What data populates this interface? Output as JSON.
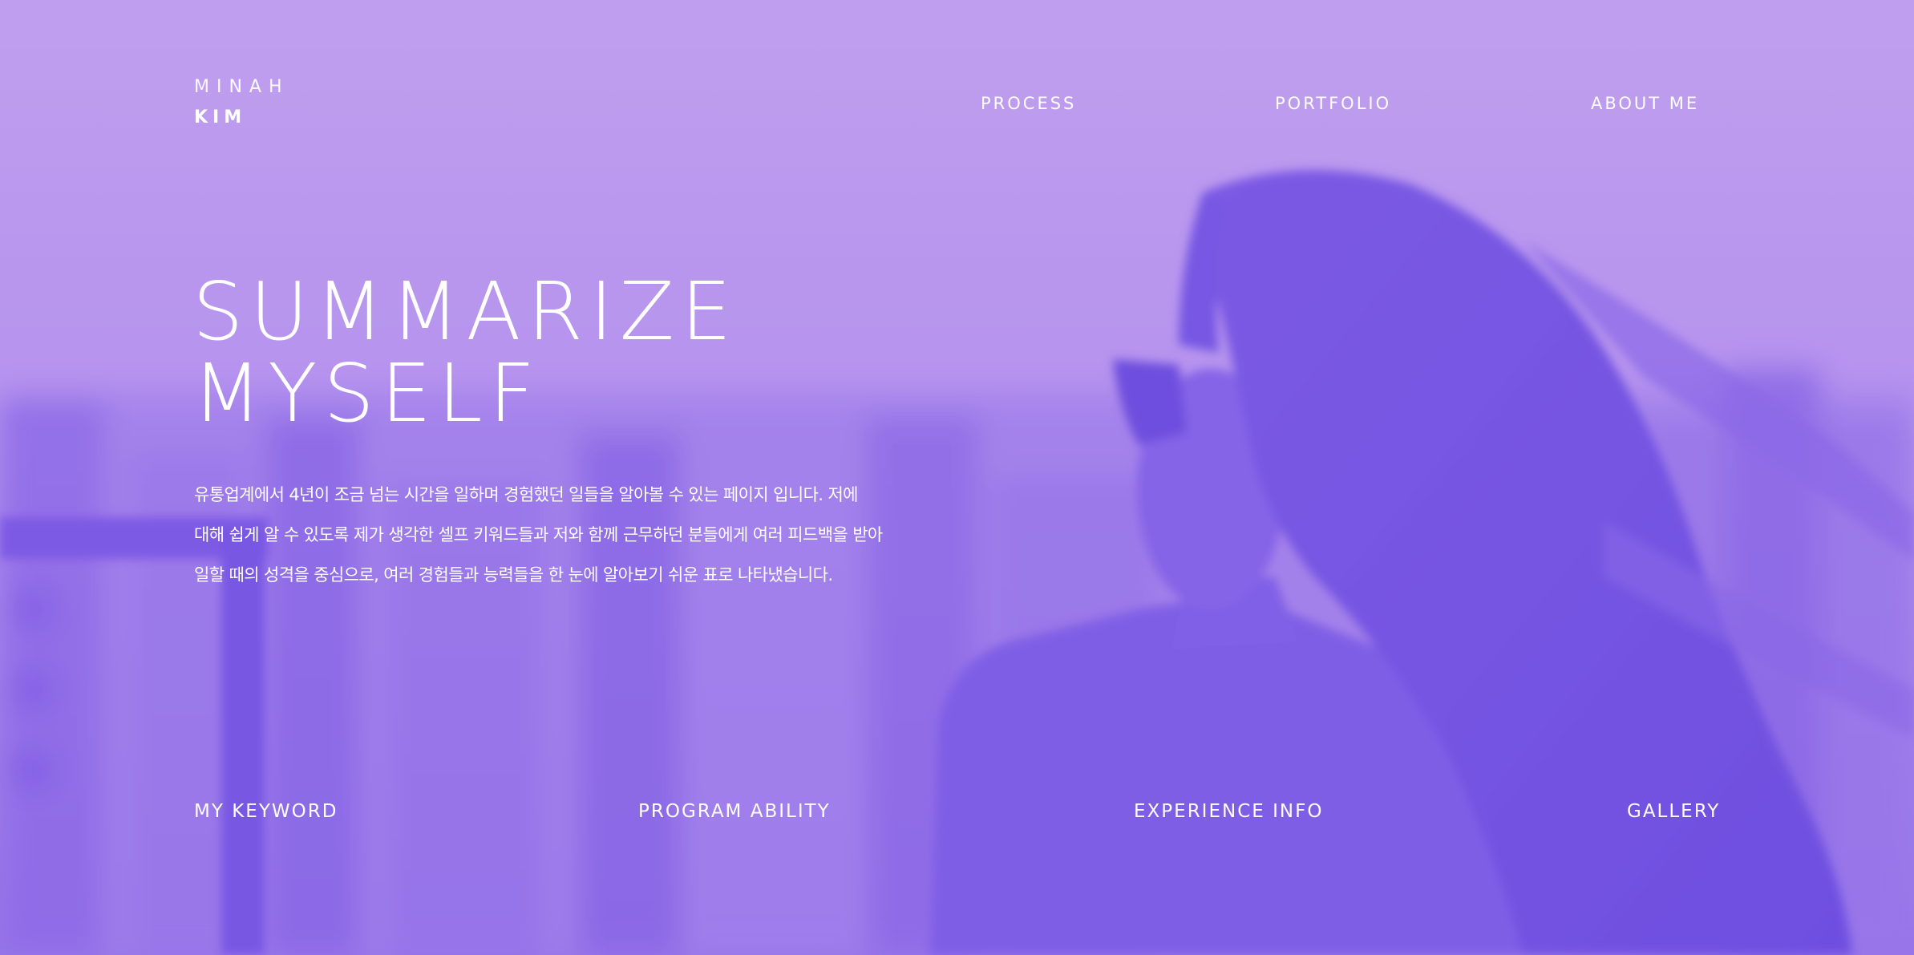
{
  "logo": {
    "first_name": "MINAH",
    "last_name": "KIM"
  },
  "top_nav": {
    "items": [
      "PROCESS",
      "PORTFOLIO",
      "ABOUT ME"
    ]
  },
  "hero": {
    "title_line1": "SUMMARIZE",
    "title_line2": "MYSELF",
    "description": "유통업계에서 4년이 조금 넘는 시간을 일하며 경험했던 일들을 알아볼 수 있는 페이지 입니다. 저에 대해 쉽게 알 수 있도록 제가 생각한 셀프 키워드들과 저와 함께 근무하던 분들에게 여러 피드백을 받아 일할 때의 성격을 중심으로, 여러 경험들과 능력들을 한 눈에 알아보기 쉬운 표로 나타냈습니다."
  },
  "bottom_nav": {
    "items": [
      "MY KEYWORD",
      "PROGRAM ABILITY",
      "EXPERIENCE INFO",
      "GALLERY"
    ]
  },
  "colors": {
    "overlay_light": "#c4a2f0",
    "overlay_mid": "#9d7aec",
    "overlay_dark": "#7455e3",
    "text": "#ffffff"
  },
  "background": {
    "icon": "woman-back-view-photo"
  }
}
